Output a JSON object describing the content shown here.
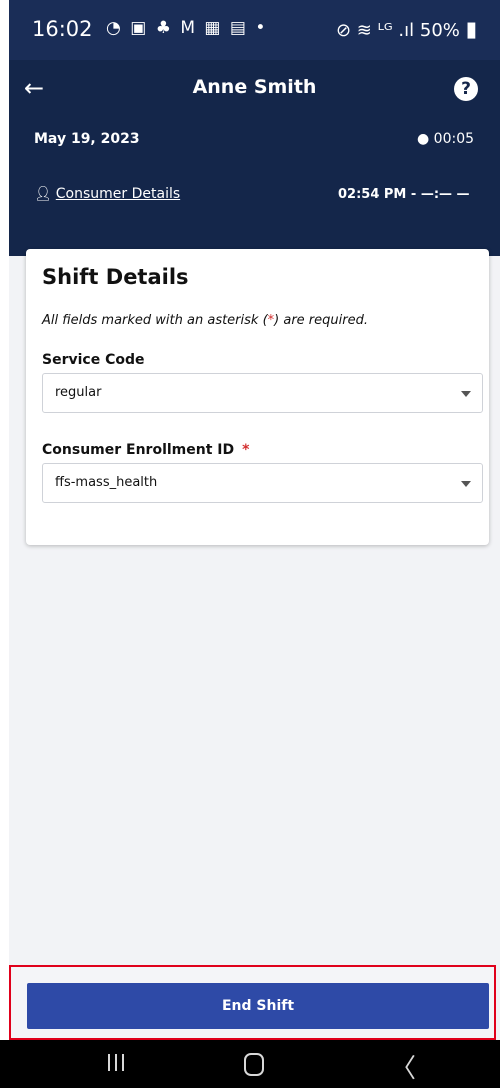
{
  "status_bar": {
    "time": "16:02",
    "icons": [
      "whatsapp-icon",
      "teams-icon",
      "person-icon",
      "gmail-icon",
      "calendar-icon",
      "mail-icon",
      "dot-icon"
    ],
    "icon_glyphs": "◔ ▣ ♣ M ▦ ▤ •",
    "right_glyphs": "⊘ ≋ ᴸᴳ .ıl",
    "battery": "50%"
  },
  "header": {
    "title": "Anne Smith",
    "date": "May 19, 2023",
    "timer": "00:05",
    "consumer_link": "Consumer Details",
    "shift_times": "02:54 PM - —:— —"
  },
  "card": {
    "title": "Shift Details",
    "note_prefix": "All fields marked with an asterisk (",
    "note_star": "*",
    "note_suffix": ") are required.",
    "service_code": {
      "label": "Service Code",
      "value": "regular"
    },
    "enrollment": {
      "label": "Consumer Enrollment ID",
      "required": "*",
      "value": "ffs-mass_health"
    }
  },
  "footer": {
    "end_shift_label": "End Shift"
  },
  "colors": {
    "header_bg": "#14264a",
    "button": "#2e4aa7",
    "highlight": "#e0001b",
    "required": "#d32f2f"
  }
}
